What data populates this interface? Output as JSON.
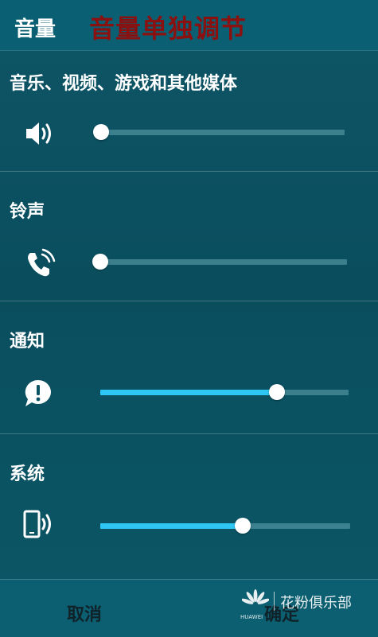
{
  "header": {
    "title": "音量",
    "overlay_caption": "音量单独调节"
  },
  "sections": [
    {
      "label": "音乐、视频、游戏和其他媒体",
      "icon": "speaker-icon",
      "level": 0.0
    },
    {
      "label": "铃声",
      "icon": "phone-ring-icon",
      "level": 0.0
    },
    {
      "label": "通知",
      "icon": "notification-bubble-icon",
      "level": 0.71
    },
    {
      "label": "系统",
      "icon": "device-sound-icon",
      "level": 0.57
    }
  ],
  "footer": {
    "cancel_label": "取消",
    "confirm_label": "确定"
  },
  "watermark": {
    "text": "花粉俱乐部",
    "brand": "HUAWEI"
  },
  "colors": {
    "accent": "#2ec6f2",
    "background": "#0a4e5e",
    "overlay_caption": "#8b1010"
  }
}
